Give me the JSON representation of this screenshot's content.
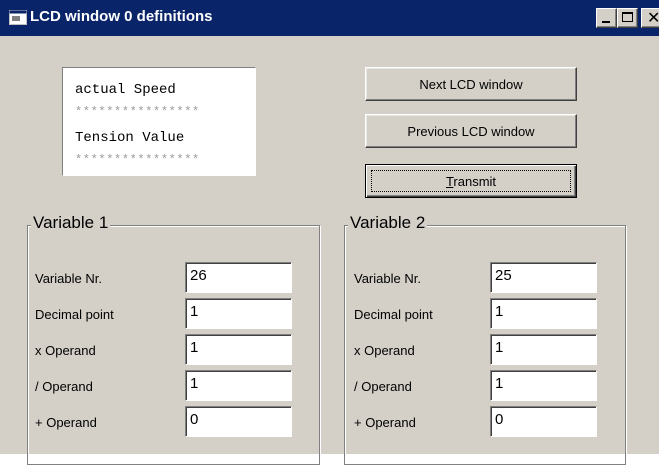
{
  "window": {
    "title": "LCD window 0 definitions",
    "active_title_color": "#0a246a",
    "face_color": "#d4d0c8"
  },
  "title_buttons": [
    "minimize-icon",
    "maximize-icon",
    "close-icon"
  ],
  "lcd_preview": {
    "line1": "actual Speed",
    "line2": "****************",
    "line3": "Tension Value",
    "line4": "****************"
  },
  "buttons": {
    "next": "Next LCD window",
    "previous": "Previous LCD window",
    "transmit_mnemonic": "T",
    "transmit_rest": "ransmit"
  },
  "variable1": {
    "legend": "Variable 1",
    "rows": [
      {
        "label": "Variable Nr.",
        "value": "26"
      },
      {
        "label": "Decimal point",
        "value": "1"
      },
      {
        "label": "x Operand",
        "value": "1"
      },
      {
        "label": "/ Operand",
        "value": "1"
      },
      {
        "label": "+ Operand",
        "value": "0"
      }
    ]
  },
  "variable2": {
    "legend": "Variable 2",
    "rows": [
      {
        "label": "Variable Nr.",
        "value": "25"
      },
      {
        "label": "Decimal point",
        "value": "1"
      },
      {
        "label": "x Operand",
        "value": "1"
      },
      {
        "label": "/ Operand",
        "value": "1"
      },
      {
        "label": "+ Operand",
        "value": "0"
      }
    ]
  }
}
